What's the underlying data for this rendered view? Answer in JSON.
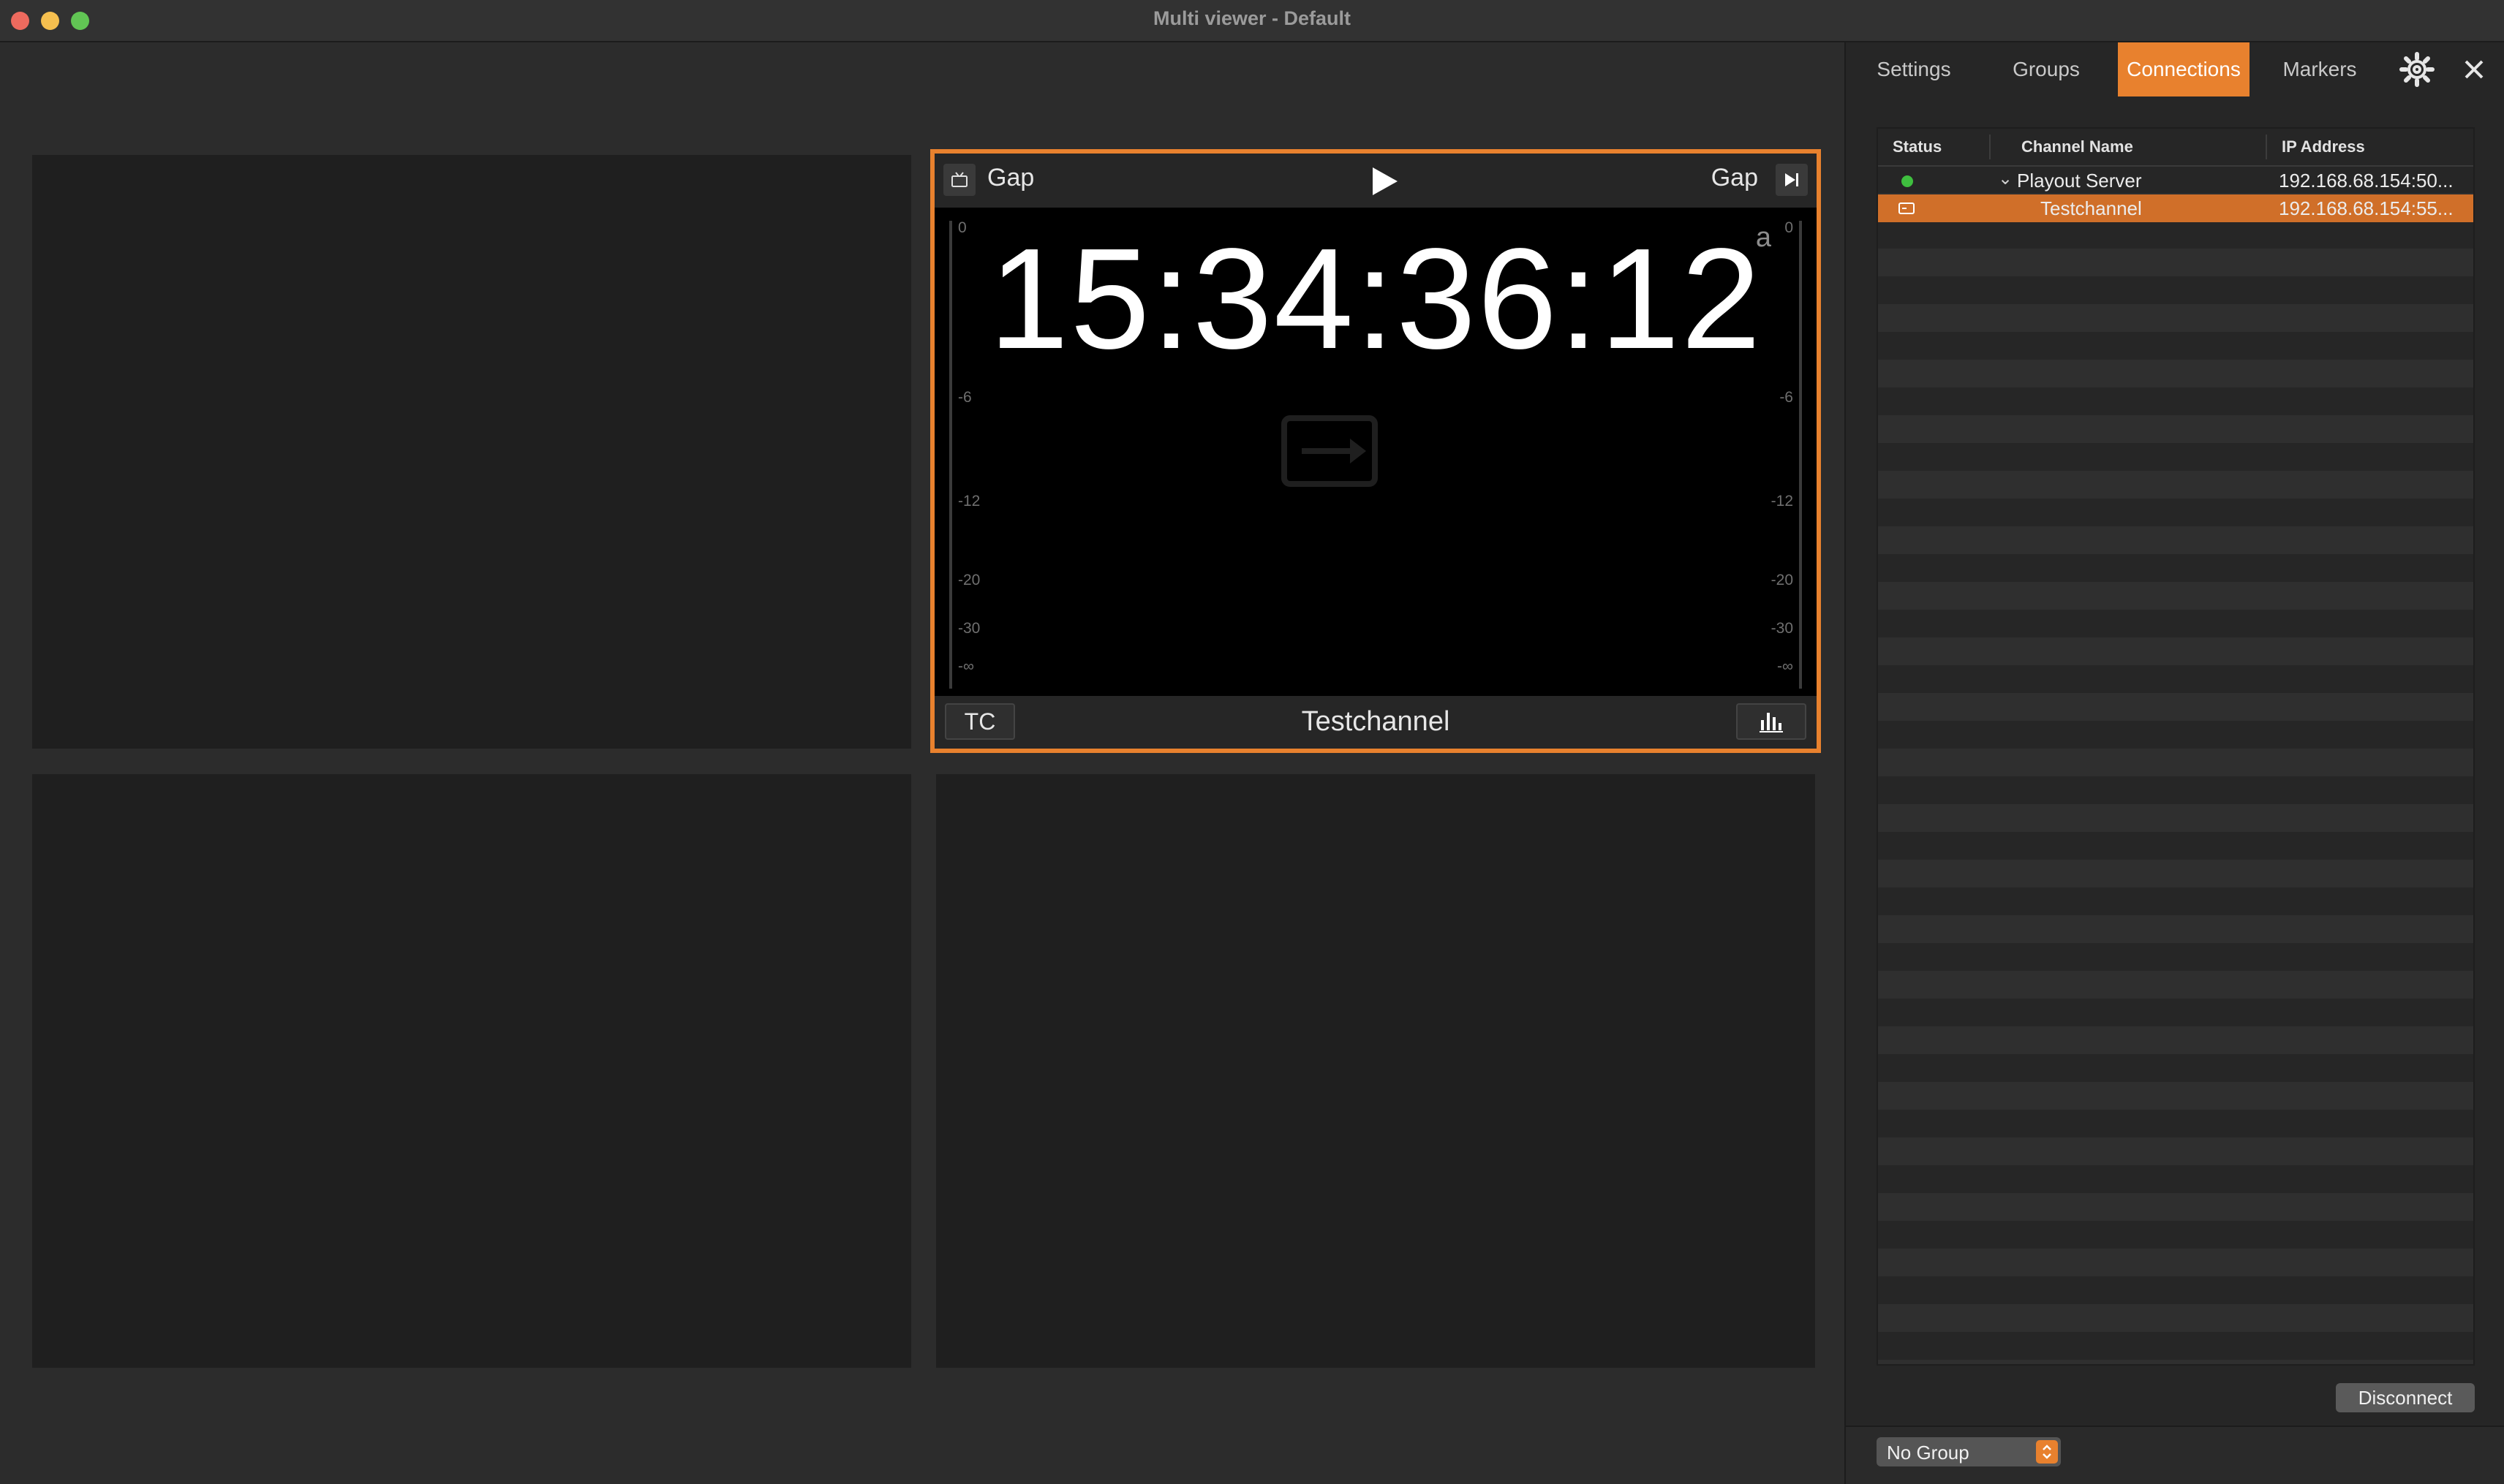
{
  "window": {
    "title": "Multi viewer - Default"
  },
  "viewer": {
    "header_left_label": "Gap",
    "header_right_label": "Gap",
    "timecode": "15:34:36:12",
    "brand_faint": "a",
    "meter_ticks": [
      "0",
      "-6",
      "-12",
      "-20",
      "-30",
      "-∞"
    ],
    "tc_button_label": "TC",
    "channel_name": "Testchannel"
  },
  "panel": {
    "tabs": [
      "Settings",
      "Groups",
      "Connections",
      "Markers"
    ],
    "active_tab": "Connections",
    "table": {
      "columns": [
        "Status",
        "Channel Name",
        "IP Address"
      ],
      "rows": [
        {
          "status": "connected",
          "name": "Playout Server",
          "ip": "192.168.68.154:50..."
        },
        {
          "status": "channel",
          "name": "Testchannel",
          "ip": "192.168.68.154:55..."
        }
      ]
    },
    "disconnect_label": "Disconnect",
    "group_select_value": "No Group"
  },
  "colors": {
    "accent": "#e8812e",
    "selected_row": "#d06f29",
    "status_connected": "#3fbf3f"
  }
}
